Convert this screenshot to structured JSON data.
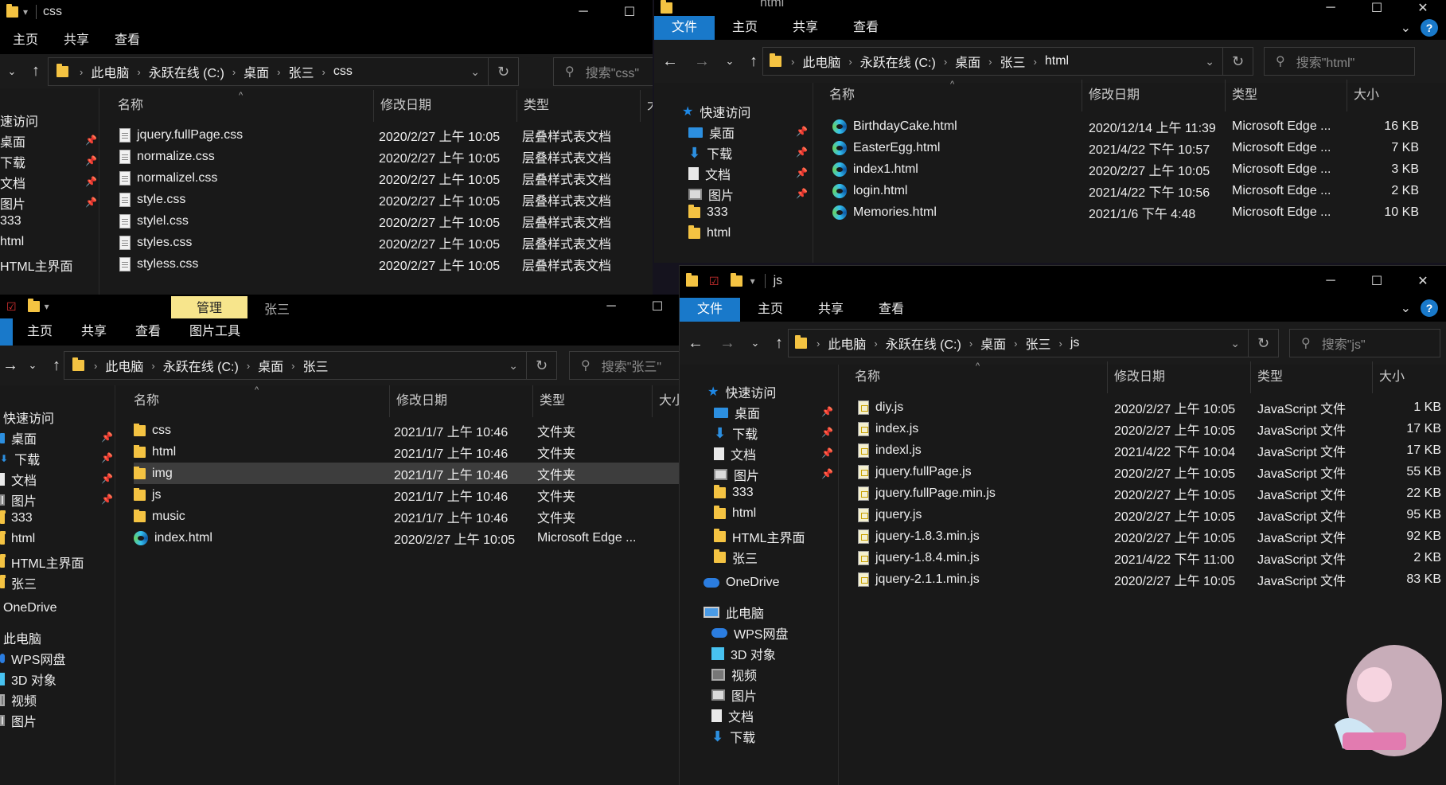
{
  "css_window": {
    "title": "css",
    "ribbon": [
      "主页",
      "共享",
      "查看"
    ],
    "address": [
      "此电脑",
      "永跃在线 (C:)",
      "桌面",
      "张三",
      "css"
    ],
    "search_placeholder": "搜索\"css\"",
    "nav": [
      "速访问",
      "桌面",
      "下载",
      "文档",
      "图片",
      "333",
      "html",
      "HTML主界面"
    ],
    "columns": [
      "名称",
      "修改日期",
      "类型",
      "大"
    ],
    "files": [
      {
        "name": "jquery.fullPage.css",
        "date": "2020/2/27 上午 10:05",
        "type": "层叠样式表文档"
      },
      {
        "name": "normalize.css",
        "date": "2020/2/27 上午 10:05",
        "type": "层叠样式表文档"
      },
      {
        "name": "normalizel.css",
        "date": "2020/2/27 上午 10:05",
        "type": "层叠样式表文档"
      },
      {
        "name": "style.css",
        "date": "2020/2/27 上午 10:05",
        "type": "层叠样式表文档"
      },
      {
        "name": "stylel.css",
        "date": "2020/2/27 上午 10:05",
        "type": "层叠样式表文档"
      },
      {
        "name": "styles.css",
        "date": "2020/2/27 上午 10:05",
        "type": "层叠样式表文档"
      },
      {
        "name": "styless.css",
        "date": "2020/2/27 上午 10:05",
        "type": "层叠样式表文档"
      }
    ]
  },
  "html_window": {
    "title": "html",
    "ribbon": [
      "文件",
      "主页",
      "共享",
      "查看"
    ],
    "address": [
      "此电脑",
      "永跃在线 (C:)",
      "桌面",
      "张三",
      "html"
    ],
    "search_placeholder": "搜索\"html\"",
    "nav": [
      "快速访问",
      "桌面",
      "下载",
      "文档",
      "图片",
      "333",
      "html"
    ],
    "columns": [
      "名称",
      "修改日期",
      "类型",
      "大小"
    ],
    "files": [
      {
        "name": "BirthdayCake.html",
        "date": "2020/12/14 上午 11:39",
        "type": "Microsoft Edge ...",
        "size": "16 KB"
      },
      {
        "name": "EasterEgg.html",
        "date": "2021/4/22 下午 10:57",
        "type": "Microsoft Edge ...",
        "size": "7 KB"
      },
      {
        "name": "index1.html",
        "date": "2020/2/27 上午 10:05",
        "type": "Microsoft Edge ...",
        "size": "3 KB"
      },
      {
        "name": "login.html",
        "date": "2021/4/22 下午 10:56",
        "type": "Microsoft Edge ...",
        "size": "2 KB"
      },
      {
        "name": "Memories.html",
        "date": "2021/1/6 下午 4:48",
        "type": "Microsoft Edge ...",
        "size": "10 KB"
      }
    ]
  },
  "zhangsan_window": {
    "title": "张三",
    "manage_tab": "管理",
    "ribbon": [
      "主页",
      "共享",
      "查看",
      "图片工具"
    ],
    "address": [
      "此电脑",
      "永跃在线 (C:)",
      "桌面",
      "张三"
    ],
    "search_placeholder": "搜索\"张三\"",
    "nav": [
      "快速访问",
      "桌面",
      "下载",
      "文档",
      "图片",
      "333",
      "html",
      "HTML主界面",
      "张三",
      "OneDrive",
      "此电脑",
      "WPS网盘",
      "3D 对象",
      "视频",
      "图片"
    ],
    "columns": [
      "名称",
      "修改日期",
      "类型",
      "大小"
    ],
    "files": [
      {
        "name": "css",
        "date": "2021/1/7 上午 10:46",
        "type": "文件夹",
        "icon": "folder"
      },
      {
        "name": "html",
        "date": "2021/1/7 上午 10:46",
        "type": "文件夹",
        "icon": "folder"
      },
      {
        "name": "img",
        "date": "2021/1/7 上午 10:46",
        "type": "文件夹",
        "icon": "folder",
        "selected": true
      },
      {
        "name": "js",
        "date": "2021/1/7 上午 10:46",
        "type": "文件夹",
        "icon": "folder"
      },
      {
        "name": "music",
        "date": "2021/1/7 上午 10:46",
        "type": "文件夹",
        "icon": "folder"
      },
      {
        "name": "index.html",
        "date": "2020/2/27 上午 10:05",
        "type": "Microsoft Edge ...",
        "icon": "edge"
      }
    ]
  },
  "js_window": {
    "title": "js",
    "ribbon": [
      "文件",
      "主页",
      "共享",
      "查看"
    ],
    "address": [
      "此电脑",
      "永跃在线 (C:)",
      "桌面",
      "张三",
      "js"
    ],
    "search_placeholder": "搜索\"js\"",
    "nav": [
      "快速访问",
      "桌面",
      "下载",
      "文档",
      "图片",
      "333",
      "html",
      "HTML主界面",
      "张三",
      "OneDrive",
      "此电脑",
      "WPS网盘",
      "3D 对象",
      "视频",
      "图片",
      "文档",
      "下载"
    ],
    "columns": [
      "名称",
      "修改日期",
      "类型",
      "大小"
    ],
    "files": [
      {
        "name": "diy.js",
        "date": "2020/2/27 上午 10:05",
        "type": "JavaScript 文件",
        "size": "1 KB"
      },
      {
        "name": "index.js",
        "date": "2020/2/27 上午 10:05",
        "type": "JavaScript 文件",
        "size": "17 KB"
      },
      {
        "name": "indexl.js",
        "date": "2021/4/22 下午 10:04",
        "type": "JavaScript 文件",
        "size": "17 KB"
      },
      {
        "name": "jquery.fullPage.js",
        "date": "2020/2/27 上午 10:05",
        "type": "JavaScript 文件",
        "size": "55 KB"
      },
      {
        "name": "jquery.fullPage.min.js",
        "date": "2020/2/27 上午 10:05",
        "type": "JavaScript 文件",
        "size": "22 KB"
      },
      {
        "name": "jquery.js",
        "date": "2020/2/27 上午 10:05",
        "type": "JavaScript 文件",
        "size": "95 KB"
      },
      {
        "name": "jquery-1.8.3.min.js",
        "date": "2020/2/27 上午 10:05",
        "type": "JavaScript 文件",
        "size": "92 KB"
      },
      {
        "name": "jquery-1.8.4.min.js",
        "date": "2021/4/22 下午 11:00",
        "type": "JavaScript 文件",
        "size": "2 KB"
      },
      {
        "name": "jquery-2.1.1.min.js",
        "date": "2020/2/27 上午 10:05",
        "type": "JavaScript 文件",
        "size": "83 KB"
      }
    ]
  },
  "colors": {
    "accent": "#1979ca",
    "manage": "#f7e58c",
    "folder": "#f4c342"
  }
}
